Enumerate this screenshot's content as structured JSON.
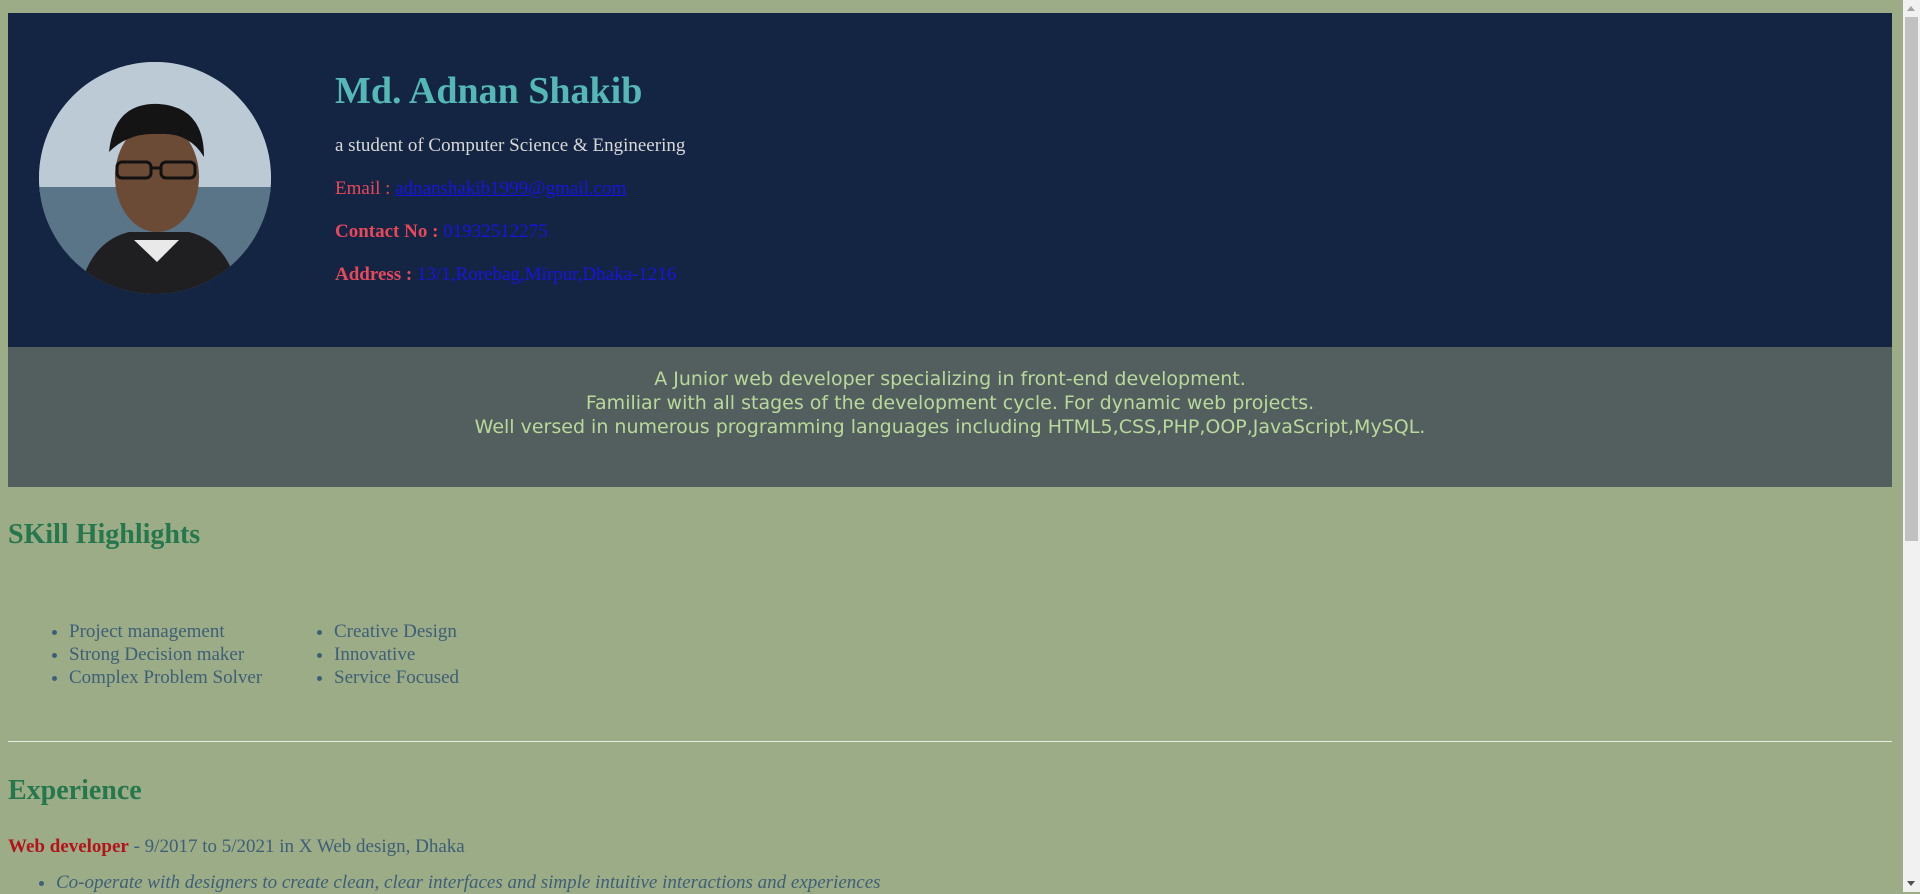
{
  "header": {
    "name": "Md. Adnan Shakib",
    "subtitle": "a student of Computer Science & Engineering",
    "email_label": "Email : ",
    "email": "adnanshakib1999@gmail.com",
    "contact_label": "Contact No : ",
    "contact": "01932512275",
    "address_label": "Address : ",
    "address": "13/1,Rorebag,Mirpur,Dhaka-1216"
  },
  "summary": {
    "line1": "A Junior web developer specializing in front-end development.",
    "line2": "Familiar with all stages of the development cycle. For dynamic web projects.",
    "line3": "Well versed in numerous programming languages including HTML5,CSS,PHP,OOP,JavaScript,MySQL."
  },
  "skills": {
    "heading": "SKill Highlights",
    "col1": [
      "Project management",
      "Strong Decision maker",
      "Complex Problem Solver"
    ],
    "col2": [
      "Creative Design",
      "Innovative",
      "Service Focused"
    ]
  },
  "experience": {
    "heading": "Experience",
    "role": "Web developer",
    "details": " - 9/2017 to 5/2021 in X Web design, Dhaka",
    "item1": "Co-operate with designers to create clean, clear interfaces and simple intuitive interactions and experiences"
  },
  "colors": {
    "page_bg": "#9bac86",
    "header_bg": "#132542",
    "summary_bg": "#535f5e",
    "name": "#55b8b6",
    "label": "#e8485b",
    "link": "#1a14e0",
    "section_heading": "#26774d",
    "role": "#b1141a"
  }
}
